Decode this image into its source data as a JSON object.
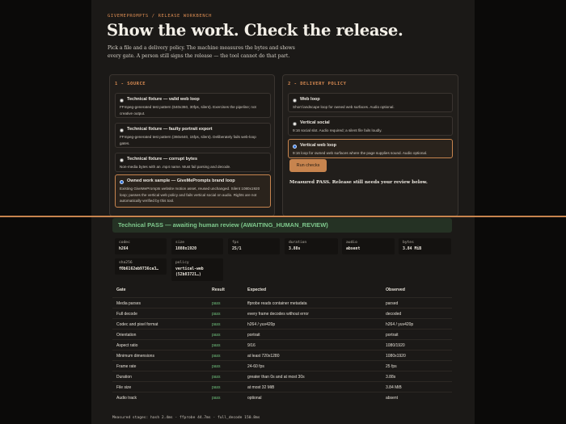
{
  "brand": "GIVEMEPROMPTS / RELEASE WORKBENCH",
  "title": "Show the work. Check the release.",
  "intro": "Pick a file and a delivery policy. The machine measures the bytes and shows every gate. A person still signs the release — the tool cannot do that part.",
  "source": {
    "heading": "1 - SOURCE",
    "options": [
      {
        "title": "Technical fixture — valid web loop",
        "desc": "FFmpeg-generated test pattern (640x360, 30fps, silent). Exercises the pipeline; not creative output.",
        "selected": false
      },
      {
        "title": "Technical fixture — faulty portrait export",
        "desc": "FFmpeg-generated test pattern (360x640, 15fps, silent). Deliberately fails web-loop gates.",
        "selected": false
      },
      {
        "title": "Technical fixture — corrupt bytes",
        "desc": "Non-media bytes with an .mp4 name. Must fail parsing and decode.",
        "selected": false
      },
      {
        "title": "Owned work sample — GiveMePrompts brand loop",
        "desc": "Existing GiveMePrompts website motion asset, reused unchanged. Silent 1080x1920 loop; passes the vertical web policy and fails vertical social on audio. Rights are not automatically verified by this tool.",
        "selected": true
      }
    ]
  },
  "delivery": {
    "heading": "2 - DELIVERY POLICY",
    "options": [
      {
        "title": "Web loop",
        "desc": "Short landscape loop for owned web surfaces. Audio optional.",
        "selected": false
      },
      {
        "title": "Vertical social",
        "desc": "9:16 social slot. Audio required; a silent file fails loudly.",
        "selected": false
      },
      {
        "title": "Vertical web loop",
        "desc": "9:16 loop for owned web surfaces where the page supplies sound. Audio optional.",
        "selected": true
      }
    ],
    "run_label": "Run checks",
    "measured": "Measured PASS. Release still needs your review below."
  },
  "status": "Technical PASS — awaiting human review (AWAITING_HUMAN_REVIEW)",
  "metrics": [
    {
      "label": "codec",
      "value": "h264"
    },
    {
      "label": "size",
      "value": "1080x1920"
    },
    {
      "label": "fps",
      "value": "25/1"
    },
    {
      "label": "duration",
      "value": "3.88s"
    },
    {
      "label": "audio",
      "value": "absent"
    },
    {
      "label": "bytes",
      "value": "3.84 MiB"
    }
  ],
  "metrics2": [
    {
      "label": "sha256",
      "value": "f0b6162eb9736ca3…"
    },
    {
      "label": "policy",
      "value": "vertical-web",
      "value2": "(52b83721…)"
    }
  ],
  "table": {
    "headers": [
      "Gate",
      "Result",
      "Expected",
      "Observed"
    ],
    "rows": [
      {
        "gate": "Media parses",
        "result": "pass",
        "expected": "ffprobe reads container metadata",
        "observed": "parsed"
      },
      {
        "gate": "Full decode",
        "result": "pass",
        "expected": "every frame decodes without error",
        "observed": "decoded"
      },
      {
        "gate": "Codec and pixel format",
        "result": "pass",
        "expected": "h264 / yuv420p",
        "observed": "h264 / yuv420p"
      },
      {
        "gate": "Orientation",
        "result": "pass",
        "expected": "portrait",
        "observed": "portrait"
      },
      {
        "gate": "Aspect ratio",
        "result": "pass",
        "expected": "9/16",
        "observed": "1080/1920"
      },
      {
        "gate": "Minimum dimensions",
        "result": "pass",
        "expected": "at least 720x1280",
        "observed": "1080x1920"
      },
      {
        "gate": "Frame rate",
        "result": "pass",
        "expected": "24-60 fps",
        "observed": "25 fps"
      },
      {
        "gate": "Duration",
        "result": "pass",
        "expected": "greater than 0s and at most 30s",
        "observed": "3.88s"
      },
      {
        "gate": "File size",
        "result": "pass",
        "expected": "at most 32 MiB",
        "observed": "3.84 MiB"
      },
      {
        "gate": "Audio track",
        "result": "pass",
        "expected": "optional",
        "observed": "absent"
      }
    ]
  },
  "stages": "Measured stages: hash 2.4ms · ffprobe 44.7ms · full_decode 150.8ms",
  "colors": {
    "accent": "#c7844e",
    "pass": "#6fbf7c",
    "background": "#1b1917"
  }
}
